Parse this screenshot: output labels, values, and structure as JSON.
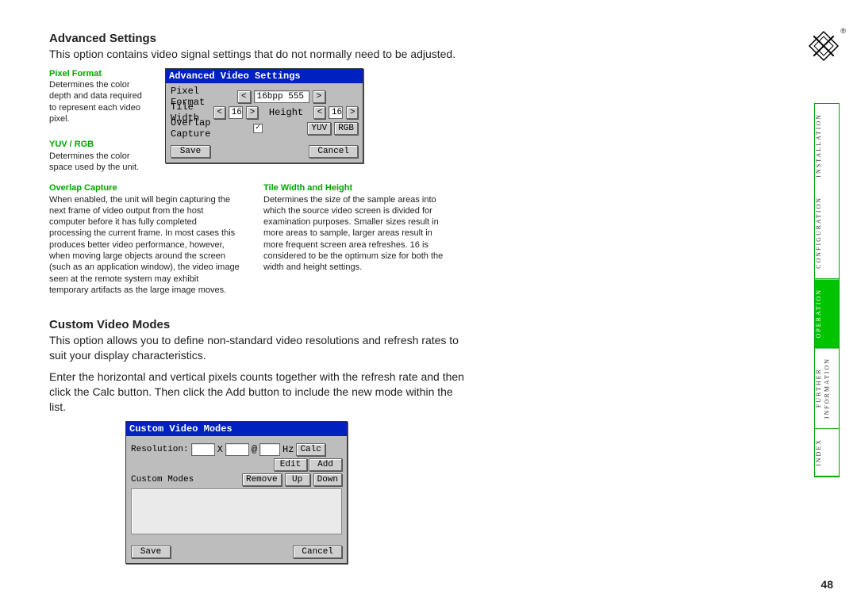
{
  "logo_reg": "®",
  "page_number": "48",
  "adv": {
    "heading": "Advanced Settings",
    "intro": "This option contains video signal settings that do not normally need to be adjusted.",
    "pixel_format_label": "Pixel Format",
    "pixel_format_body": "Determines the color depth and data required to represent each video pixel.",
    "yuv_label": "YUV / RGB",
    "yuv_body": "Determines the color space used by the unit.",
    "dlg_title": "Advanced Video Settings",
    "dlg_pixel_format": "Pixel Format",
    "dlg_pixel_value": "16bpp 555",
    "dlg_tile_width": "Tile Width",
    "dlg_tile_width_val": "16",
    "dlg_height": "Height",
    "dlg_height_val": "16",
    "dlg_overlap": "Overlap Capture",
    "dlg_overlap_check": "✓",
    "dlg_yuv": "YUV",
    "dlg_rgb": "RGB",
    "dlg_save": "Save",
    "dlg_cancel": "Cancel",
    "lt": "<",
    "gt": ">",
    "overlap_label": "Overlap Capture",
    "overlap_body": "When enabled, the unit will begin capturing the next frame of video output from the host computer before it has fully completed processing the current frame. In most cases this produces better video performance, however, when moving large objects around the screen (such as an application window), the video image seen at the remote system may exhibit temporary artifacts as the large image moves.",
    "tile_label": "Tile Width and Height",
    "tile_body": "Determines the size of the sample areas into which the source video screen is divided for examination purposes. Smaller sizes result in more areas to sample, larger areas result in more frequent screen area refreshes. 16 is considered to be the optimum size for both the width and height settings."
  },
  "cvm": {
    "heading": "Custom Video Modes",
    "intro1": "This option allows you to define non-standard video resolutions and refresh rates to suit your display characteristics.",
    "intro2": "Enter the horizontal and vertical pixels counts together with the refresh rate and then click the Calc button. Then click the Add button to include the new mode within the list.",
    "dlg_title": "Custom Video Modes",
    "resolution": "Resolution:",
    "x": "X",
    "at": "@",
    "hz": "Hz",
    "calc": "Calc",
    "edit": "Edit",
    "add": "Add",
    "custom_modes": "Custom Modes",
    "remove": "Remove",
    "up": "Up",
    "down": "Down",
    "save": "Save",
    "cancel": "Cancel"
  },
  "tabs": {
    "installation": "INSTALLATION",
    "configuration": "CONFIGURATION",
    "operation": "OPERATION",
    "further": "FURTHER\nINFORMATION",
    "index": "INDEX"
  }
}
